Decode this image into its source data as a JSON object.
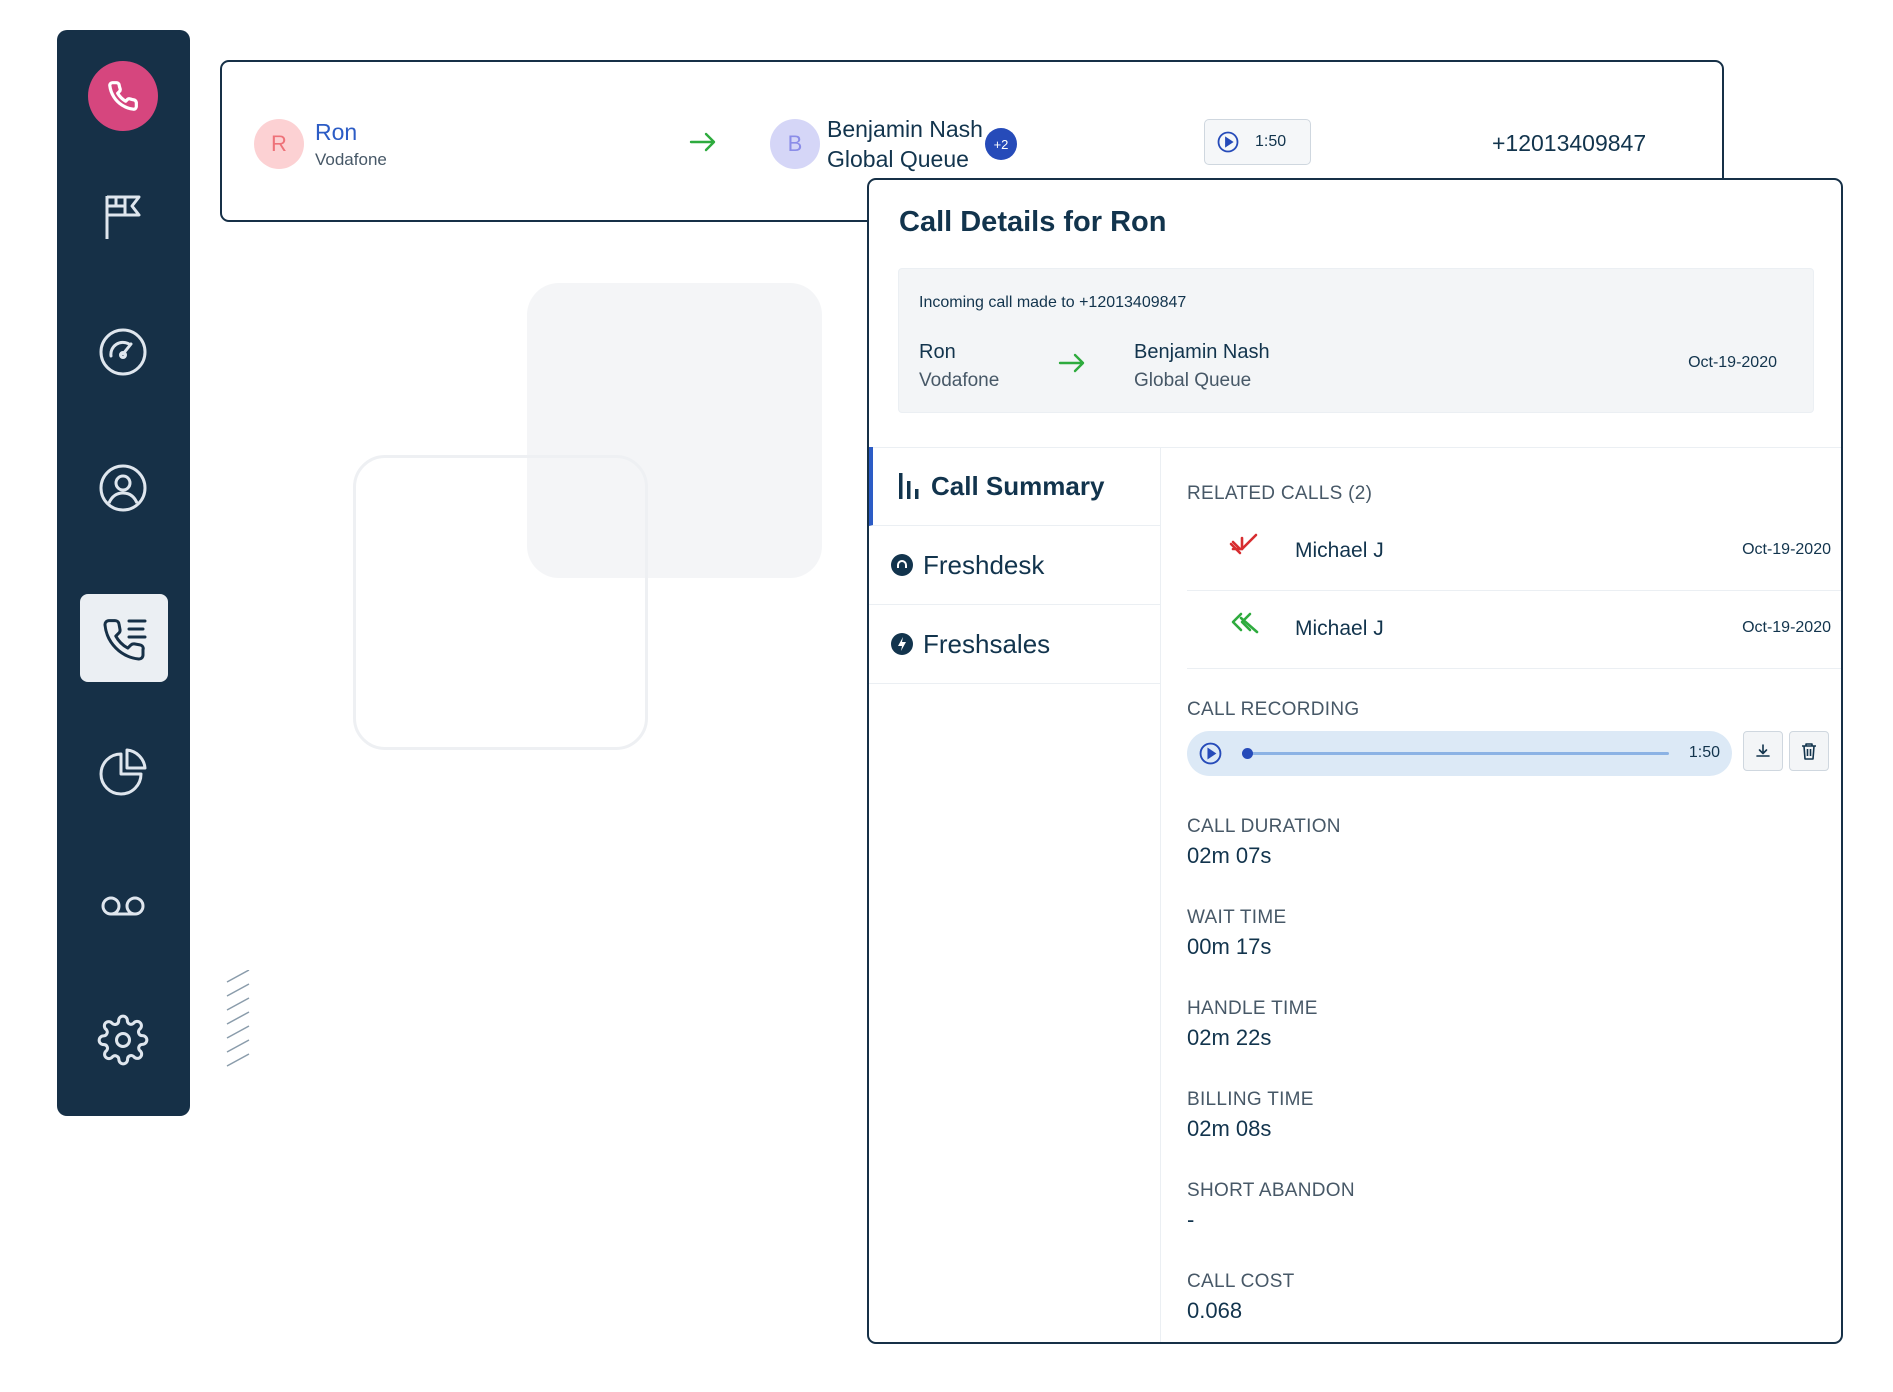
{
  "callbar": {
    "caller_initial": "R",
    "caller_name": "Ron",
    "caller_carrier": "Vodafone",
    "agent_initial": "B",
    "agent_name": "Benjamin Nash",
    "agent_queue": "Global Queue",
    "agent_badge": "+2",
    "timer": "1:50",
    "phone_number": "+12013409847"
  },
  "panel": {
    "title": "Call Details for Ron",
    "info": {
      "heading": "Incoming call made to +12013409847",
      "from_name": "Ron",
      "from_sub": "Vodafone",
      "to_name": "Benjamin Nash",
      "to_sub": "Global Queue",
      "date": "Oct-19-2020"
    },
    "tabs": [
      {
        "label": "Call Summary",
        "icon": "bar-chart-icon",
        "active": true
      },
      {
        "label": "Freshdesk",
        "icon": "freshdesk-icon",
        "active": false
      },
      {
        "label": "Freshsales",
        "icon": "freshsales-icon",
        "active": false
      }
    ],
    "related_calls": {
      "label": "RELATED CALLS (2)",
      "items": [
        {
          "name": "Michael J",
          "date": "Oct-19-2020",
          "direction": "missed",
          "color": "#d72d30"
        },
        {
          "name": "Michael J",
          "date": "Oct-19-2020",
          "direction": "incoming",
          "color": "#2eab3e"
        }
      ]
    },
    "recording": {
      "label": "CALL RECORDING",
      "time": "1:50",
      "progress": 0.0
    },
    "stats": [
      {
        "label": "CALL DURATION",
        "value": "02m 07s"
      },
      {
        "label": "WAIT TIME",
        "value": "00m 17s"
      },
      {
        "label": "HANDLE TIME",
        "value": "02m 22s"
      },
      {
        "label": "BILLING TIME",
        "value": "02m 08s"
      },
      {
        "label": "SHORT ABANDON",
        "value": "-"
      },
      {
        "label": "CALL COST",
        "value": "0.068"
      }
    ]
  },
  "colors": {
    "sidebar_bg": "#163047",
    "accent_pink": "#d6467e",
    "link_blue": "#2c5cc5",
    "arrow_green": "#2eab3e"
  },
  "sidebar": {
    "items": [
      "phone-icon",
      "flag-icon",
      "dashboard-icon",
      "contacts-icon",
      "call-log-icon",
      "reports-icon",
      "voicemail-icon",
      "settings-icon"
    ]
  }
}
